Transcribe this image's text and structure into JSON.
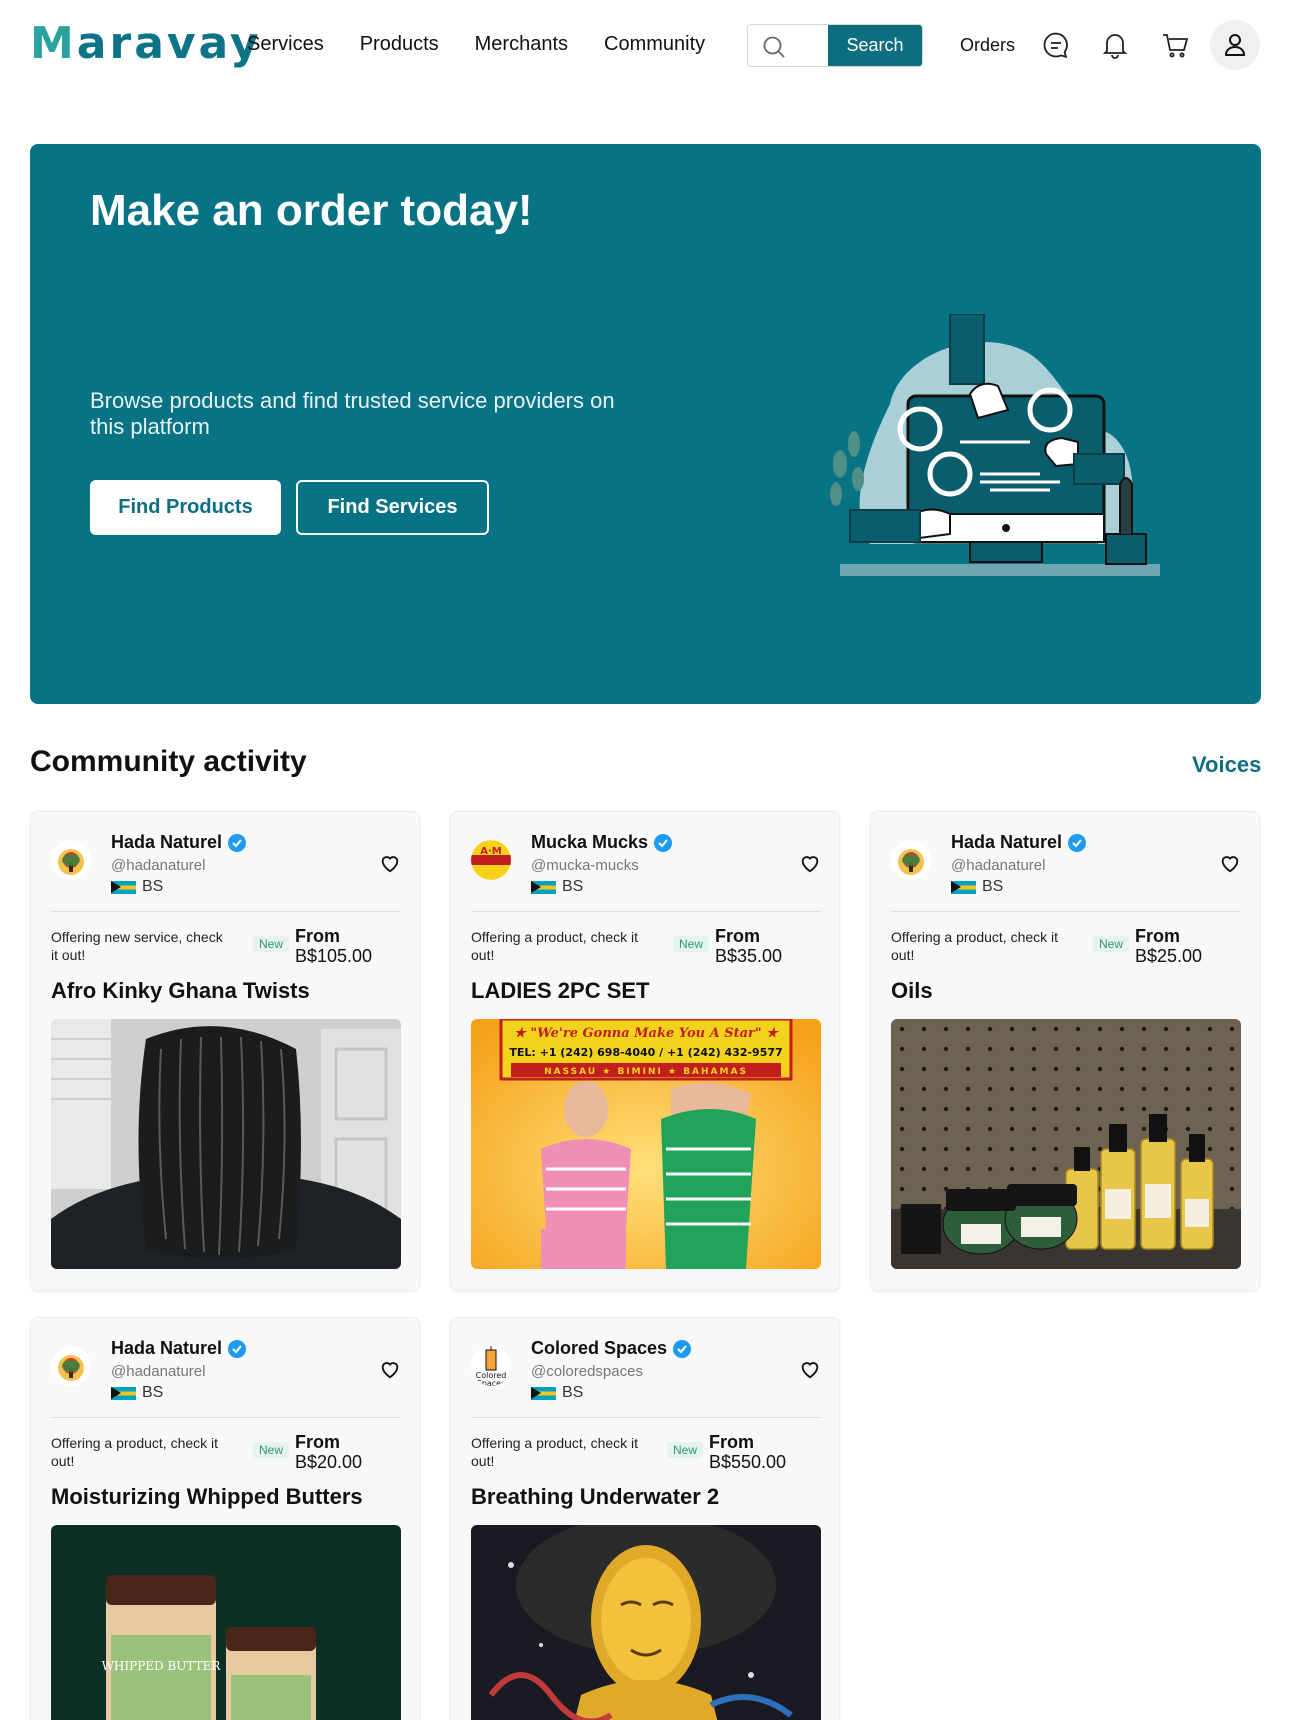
{
  "header": {
    "logo": "Maravay",
    "nav": [
      "Services",
      "Products",
      "Merchants",
      "Community"
    ],
    "search_placeholder": "",
    "search_button": "Search",
    "orders_label": "Orders",
    "icons": [
      "chat-icon",
      "bell-icon",
      "cart-icon",
      "user-icon"
    ]
  },
  "hero": {
    "title": "Make an order today!",
    "subtitle": "Browse products and find trusted service providers on this platform",
    "primary_button": "Find Products",
    "secondary_button": "Find Services"
  },
  "community": {
    "title": "Community activity",
    "link": "Voices",
    "cards": [
      {
        "name": "Hada Naturel",
        "handle": "@hadanaturel",
        "country": "BS",
        "offer": "Offering new service, check it out!",
        "badge": "New",
        "from_label": "From",
        "price": "B$105.00",
        "title": "Afro Kinky Ghana Twists",
        "image": "braided-hair-photo"
      },
      {
        "name": "Mucka Mucks",
        "handle": "@mucka-mucks",
        "country": "BS",
        "offer": "Offering a product, check it out!",
        "badge": "New",
        "from_label": "From",
        "price": "B$35.00",
        "title": "LADIES 2PC SET",
        "image": "ladies-outfit-flyer",
        "image_text": {
          "line1": "★ \"We're Gonna Make You A Star\" ★",
          "line2": "TEL: +1 (242) 698-4040 / +1 (242) 432-9577",
          "line3": "NASSAU ★ BIMINI ★ BAHAMAS"
        }
      },
      {
        "name": "Hada Naturel",
        "handle": "@hadanaturel",
        "country": "BS",
        "offer": "Offering a product, check it out!",
        "badge": "New",
        "from_label": "From",
        "price": "B$25.00",
        "title": "Oils",
        "image": "oil-bottles-photo"
      },
      {
        "name": "Hada Naturel",
        "handle": "@hadanaturel",
        "country": "BS",
        "offer": "Offering a product, check it out!",
        "badge": "New",
        "from_label": "From",
        "price": "B$20.00",
        "title": "Moisturizing Whipped Butters",
        "image": "whipped-butter-jars-photo"
      },
      {
        "name": "Colored Spaces",
        "handle": "@coloredspaces",
        "country": "BS",
        "offer": "Offering a product, check it out!",
        "badge": "New",
        "from_label": "From",
        "price": "B$550.00",
        "title": "Breathing Underwater 2",
        "image": "painting-artwork"
      }
    ]
  },
  "colors": {
    "brand": "#087385",
    "accent": "#0d6e80",
    "badge_bg": "#e5f3ec",
    "badge_text": "#2a9a70"
  }
}
